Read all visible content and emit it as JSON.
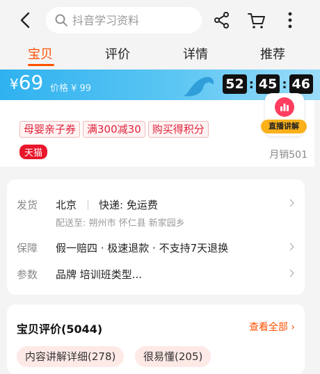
{
  "colors": {
    "accent": "#ff5000",
    "banner": "#2fb2ef",
    "tmall_red": "#e8162b",
    "live_orange": "#fbb11a"
  },
  "top_bar": {
    "search_placeholder": "抖音学习资料",
    "icons": [
      "back-icon",
      "search-icon",
      "share-icon",
      "cart-icon",
      "more-icon"
    ]
  },
  "tabs": [
    {
      "label": "宝贝",
      "active": true
    },
    {
      "label": "评价",
      "active": false
    },
    {
      "label": "详情",
      "active": false
    },
    {
      "label": "推荐",
      "active": false
    }
  ],
  "price_banner": {
    "currency": "¥",
    "price": "69",
    "original_price_label": "价格 ¥ 99",
    "countdown": [
      "52",
      "45",
      "46"
    ]
  },
  "promo": {
    "coupons": [
      "母婴亲子券",
      "满300减30",
      "购买得积分"
    ],
    "tmall_badge": "天猫",
    "monthly_sales": "月销501",
    "live_button_label": "直播讲解"
  },
  "shipping": {
    "label": "发货",
    "origin": "北京",
    "express": "快递: 免运费",
    "deliver_to": "配送至: 朔州市 怀仁县 新家园乡"
  },
  "guarantee": {
    "label": "保障",
    "text": "假一赔四 · 极速退款 · 不支持7天退换"
  },
  "params": {
    "label": "参数",
    "text": "品牌 培训班类型..."
  },
  "reviews": {
    "title": "宝贝评价(5044)",
    "view_all": "查看全部",
    "tags": [
      "内容讲解详细(278)",
      "很易懂(205)"
    ]
  }
}
